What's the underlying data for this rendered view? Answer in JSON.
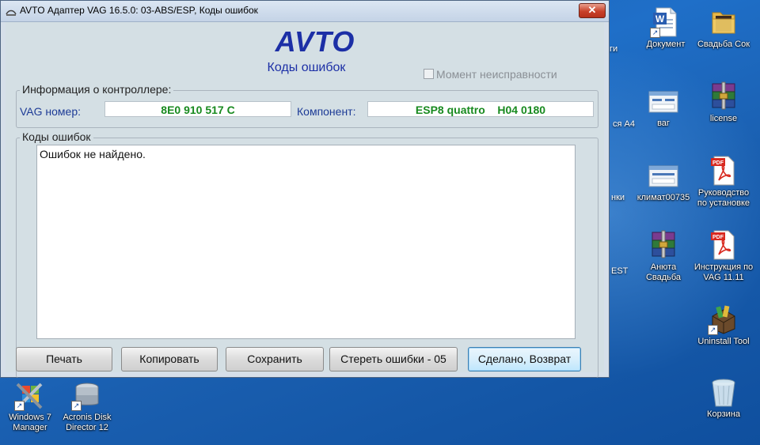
{
  "window": {
    "title": "AVTO Адаптер VAG 16.5.0: 03-ABS/ESP,  Коды ошибок",
    "close_label": "✕",
    "brand": "AVTO",
    "subtitle": "Коды ошибок",
    "moment_label": "Момент неисправности",
    "moment_checked": false,
    "controller_group_label": "Информация о контроллере:",
    "vag_label": "VAG номер:",
    "vag_value": "8E0 910 517 C",
    "component_label": "Компонент:",
    "component_value": "ESP8 quattro    H04 0180",
    "codes_group_label": "Коды ошибок",
    "codes_text": "Ошибок не найдено.",
    "buttons": {
      "print": "Печать",
      "copy": "Копировать",
      "save": "Сохранить",
      "clear": "Стереть ошибки - 05",
      "done": "Сделано, Возврат"
    }
  },
  "desktop": {
    "partial_labels": [
      "ги",
      "ся А4",
      "нки",
      "EST"
    ],
    "icons": [
      {
        "label": "Документ",
        "icon": "word-document-icon"
      },
      {
        "label": "Свадьба Сок",
        "icon": "folder-icon"
      },
      {
        "label": "ваг",
        "icon": "window-screenshot-icon"
      },
      {
        "label": "license",
        "icon": "winrar-archive-icon"
      },
      {
        "label": "климат00735",
        "icon": "window-screenshot-icon"
      },
      {
        "label": "Руководство по установке",
        "icon": "pdf-icon"
      },
      {
        "label": "Анюта Свадьба",
        "icon": "winrar-archive-icon"
      },
      {
        "label": "Инструкция по VAG 11.11",
        "icon": "pdf-icon"
      },
      {
        "label": "Uninstall Tool",
        "icon": "uninstall-tool-icon"
      },
      {
        "label": "Корзина",
        "icon": "recycle-bin-icon"
      },
      {
        "label": "Windows 7 Manager",
        "icon": "windows7-manager-icon"
      },
      {
        "label": "Acronis Disk Director 12",
        "icon": "acronis-disk-icon"
      }
    ]
  }
}
